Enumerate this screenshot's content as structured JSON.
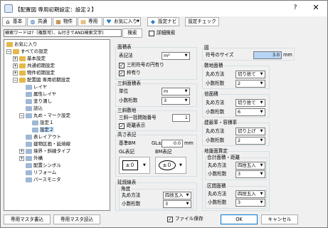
{
  "window": {
    "title": "【配置図 専用初期設定：設定２】",
    "help_glyph": "?",
    "close_glyph": "✕"
  },
  "toolbar": {
    "basic": {
      "label": "基本",
      "icon": "house-icon"
    },
    "common": {
      "label": "共通",
      "icon": "globe-icon"
    },
    "property": {
      "label": "物件",
      "icon": "building-icon"
    },
    "dedicated": {
      "label": "専用",
      "icon": "document-icon"
    },
    "favorites": {
      "label": "お気に入り",
      "icon": "heart-icon"
    },
    "settings_navi": {
      "label": "設定ナビ",
      "icon": "navi-icon"
    },
    "settings_check": {
      "label": "設定チェック"
    }
  },
  "search": {
    "value": "検索ワードは?（複数可）、&付きでAND検索文字)",
    "button": "検索",
    "detail_label": "詳細検索"
  },
  "tree": {
    "favorites": "お気に入り",
    "all_settings": "すべての設定",
    "basic_settings": "基本設定",
    "common_initial": "共通初期設定",
    "property_initial": "物件初期設定",
    "site_plan_initial": "配置図 専用初期設定",
    "layer": "レイヤ",
    "layer_attr": "属性レイヤ",
    "fill": "塗り潰し",
    "read": "読込",
    "circle_mark": "丸め・マーク設定",
    "setting1": "設定１",
    "setting2": "設定２",
    "table_layout": "表レイアウト",
    "building_area": "建物区画・延焼線",
    "boundary": "境界・斜線タイプ",
    "exterior": "外構",
    "layout_symbol": "配置シンボル",
    "reform": "リフォーム",
    "perse_monitor": "パースモニタ"
  },
  "area_table": {
    "title": "面積表",
    "notation_label": "表記法",
    "notation_value": "m²",
    "check_three_digit": "三桁符号の円有り",
    "check_frame": "枠有り"
  },
  "three_digit_area": {
    "title": "三斜面積表",
    "unit_label": "単位",
    "unit_value": "m",
    "decimals_label": "小数桁数",
    "decimals_value": "3"
  },
  "three_digit_site": {
    "title": "三斜敷地",
    "start_label": "三斜一括開始番号",
    "start_value": "1",
    "check_distance": "距離表示"
  },
  "height": {
    "title": "高さ表記",
    "base_label": "基準BM",
    "gl_label": "GL±",
    "gl_value": "0.0",
    "gl_unit": "mm",
    "gl_notation": "GL表記",
    "bm_notation": "BM表記",
    "gl_symbol": "±０",
    "bm_symbol": "±０"
  },
  "extension": {
    "title": "延焼線表",
    "angle_title": "角度",
    "rounding_label": "丸め方法",
    "rounding_value": "四捨五入",
    "decimals_label": "小数桁数",
    "decimals_value": "3"
  },
  "figure": {
    "title": "図",
    "symbol_size_label": "符号のサイズ",
    "symbol_size_value": "3.0",
    "symbol_size_unit": "mm"
  },
  "site_area": {
    "title": "敷地面積",
    "rounding_label": "丸め方法",
    "rounding_value": "切り捨て",
    "decimals_label": "小数桁数",
    "decimals_value": "2"
  },
  "frontage_area": {
    "title": "倍面積",
    "rounding_label": "丸め方法",
    "rounding_value": "切り捨て",
    "decimals_label": "小数桁数",
    "decimals_value": "6"
  },
  "building_coverage": {
    "title": "建蔽率・容積率",
    "rounding_label": "丸め方法",
    "rounding_value": "切り上げ",
    "decimals_label": "小数桁数",
    "decimals_value": "2"
  },
  "zone_area": {
    "title": "地盤面算定",
    "sub_title": "合計面積・距離",
    "rounding_label": "丸め方法",
    "rounding_value": "四捨五入",
    "decimals_label": "小数桁数",
    "decimals_value": "3",
    "sub2_title": "区間面積",
    "rounding2_value": "四捨五入",
    "decimals2_value": "3"
  },
  "footer": {
    "write_master": "専用マスタ書込",
    "read_master": "専用マスタ読込",
    "save_file_label": "ファイル保存",
    "ok": "OK",
    "cancel": "キャンセル"
  }
}
